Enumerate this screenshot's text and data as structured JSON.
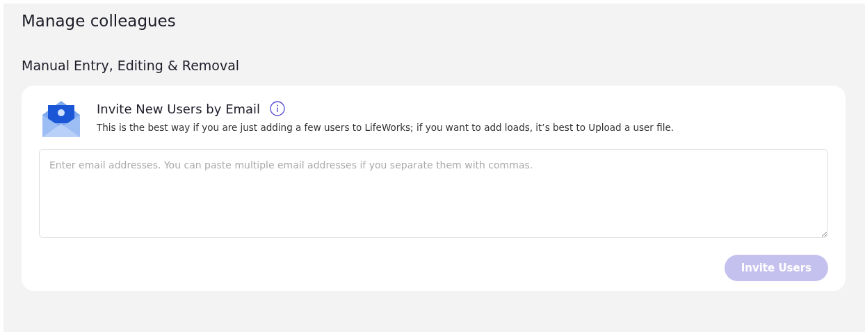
{
  "page_title": "Manage colleagues",
  "section_title": "Manual Entry, Editing & Removal",
  "invite_card": {
    "title": "Invite New Users by Email",
    "description": "This is the best way if you are just adding a few users to LifeWorks; if you want to add loads, it’s best to Upload a user file.",
    "email_field": {
      "placeholder": "Enter email addresses. You can paste multiple email addresses if you separate them with commas."
    },
    "invite_button": {
      "label": "Invite Users",
      "disabled": true
    }
  }
}
